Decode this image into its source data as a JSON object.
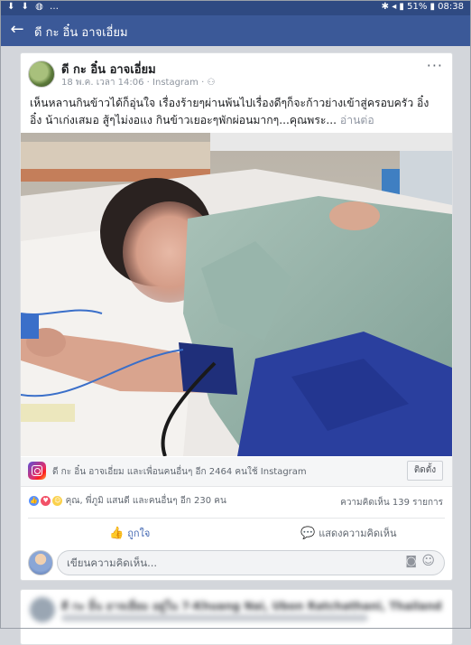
{
  "statusbar": {
    "left_icons": [
      "download-icon",
      "download-icon",
      "messenger-icon",
      "more-icon"
    ],
    "left_text": "⬇ ⬇ ◍ …",
    "right_text": "✱ ◂ ▮ 51% ▮ 08:38",
    "battery": "51%",
    "time": "08:38"
  },
  "appbar": {
    "back_icon": "arrow-left-icon",
    "back_glyph": "←",
    "title": "ดี กะ อิ๋น อาจเอี่ยม"
  },
  "post": {
    "author": "ดี กะ อิ๋น อาจเอี่ยม",
    "meta": "18 พ.ค. เวลา 14:06 · Instagram · ⚇",
    "more_glyph": "···",
    "text_line1": "เห็นหลานกินข้าวได้ก็อุ่นใจ เรื่องร้ายๆผ่านพ้นไปเรื่องดีๆก็จะก้าวย่างเข้าสู่ครอบครัว อิ๋ง",
    "text_line2": "อิ๋ง น้าเก่งเสมอ สู้ๆไม่งอแง กินข้าวเยอะๆพักผ่อนมากๆ...คุณพระ...",
    "read_more": "อ่านต่อ",
    "instagram_text": "ดี กะ อิ๋น อาจเอี่ยม และเพื่อนคนอื่นๆ อีก 2464 คนใช้ Instagram",
    "install_label": "ติดตั้ง",
    "reactions_text": "คุณ, พี่ภูมิ แสนดี และคนอื่นๆ อีก 230 คน",
    "comments_count": "ความคิดเห็น 139 รายการ",
    "like_label": "ถูกใจ",
    "comment_label": "แสดงความคิดเห็น",
    "composer_placeholder": "เขียนความคิดเห็น...",
    "reaction_glyphs": {
      "like": "👍",
      "love": "♥",
      "haha": "☺"
    }
  },
  "next_post": {
    "author_blurred": "ดี กะ อิ๋น อาจเอี่ยม อยู่ใน 7-Khuang Nai, Ubon Ratchathani, Thailand"
  },
  "colors": {
    "statusbar": "#2f4a82",
    "appbar": "#3b5998",
    "like_blue": "#4267b2",
    "background": "#d3d6db"
  }
}
